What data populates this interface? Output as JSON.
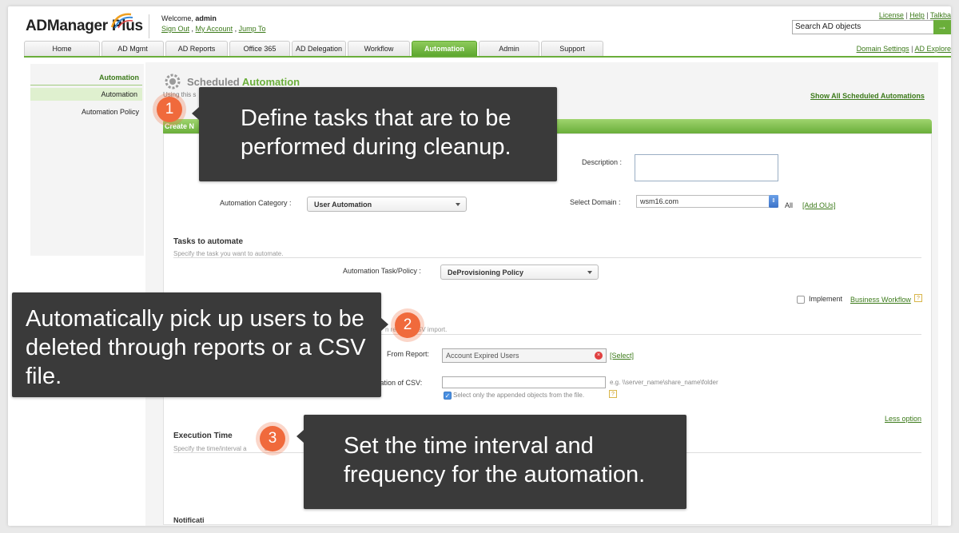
{
  "header": {
    "logo": "ADManager Plus",
    "welcome_prefix": "Welcome,",
    "username": "admin",
    "links": [
      "Sign Out",
      "My Account",
      "Jump To"
    ],
    "top_links": [
      "License",
      "Help",
      "Talkba"
    ],
    "search_value": "Search AD objects",
    "search_btn_icon": "→"
  },
  "nav": {
    "tabs": [
      "Home",
      "AD Mgmt",
      "AD Reports",
      "Office 365",
      "AD Delegation",
      "Workflow",
      "Automation",
      "Admin",
      "Support"
    ],
    "active": "Automation",
    "sub_links": [
      "Domain Settings",
      "AD Explore"
    ]
  },
  "sidebar": {
    "heading": "Automation",
    "items": [
      "Automation",
      "Automation Policy"
    ]
  },
  "main": {
    "title_part1": "Scheduled",
    "title_part2": "Automation",
    "intro_fragment": "Using this s",
    "show_all": "Show All Scheduled Automations",
    "bar_fragment": "Create N",
    "description_label": "Description :",
    "category_label": "Automation Category :",
    "category_value": "User Automation",
    "domain_label": "Select Domain :",
    "domain_value": "wsm16.com",
    "domain_all": "All",
    "add_ous": "[Add OUs]",
    "tasks_title": "Tasks to automate",
    "tasks_sub": "Specify the task you want to automate.",
    "task_policy_label": "Automation Task/Policy :",
    "task_policy_value": "DeProvisioning Policy",
    "implement_label": "Implement",
    "business_workflow": "Business Workflow",
    "help_glyph": "?",
    "csv_sub_fragment": "n re",
    "csv_sub_fragment2": "or CSV import.",
    "from_report_label": "From Report:",
    "report_value": "Account Expired Users",
    "clear_glyph": "×",
    "select_link": "[Select]",
    "csv_label": "ocation of CSV:",
    "csv_hint": "e.g. \\\\server_name\\share_name\\folder",
    "appended_label": "Select only the appended objects from the file.",
    "check_glyph": "✓",
    "less_option": "Less option",
    "exec_title": "Execution Time",
    "exec_sub": "Specify the time/interval a",
    "exec_sub2": "e ta",
    "notif_fragment": "Notificati"
  },
  "callouts": [
    {
      "number": "1",
      "text": "Define tasks that are to be performed during cleanup."
    },
    {
      "number": "2",
      "text": "Automatically pick up users to be deleted through reports or a CSV file."
    },
    {
      "number": "3",
      "text": "Set the time interval and frequency for the automation."
    }
  ],
  "colors": {
    "accent_green": "#6aae3a",
    "callout_bg": "#3a3a3a",
    "badge_orange": "#f06a3c"
  }
}
